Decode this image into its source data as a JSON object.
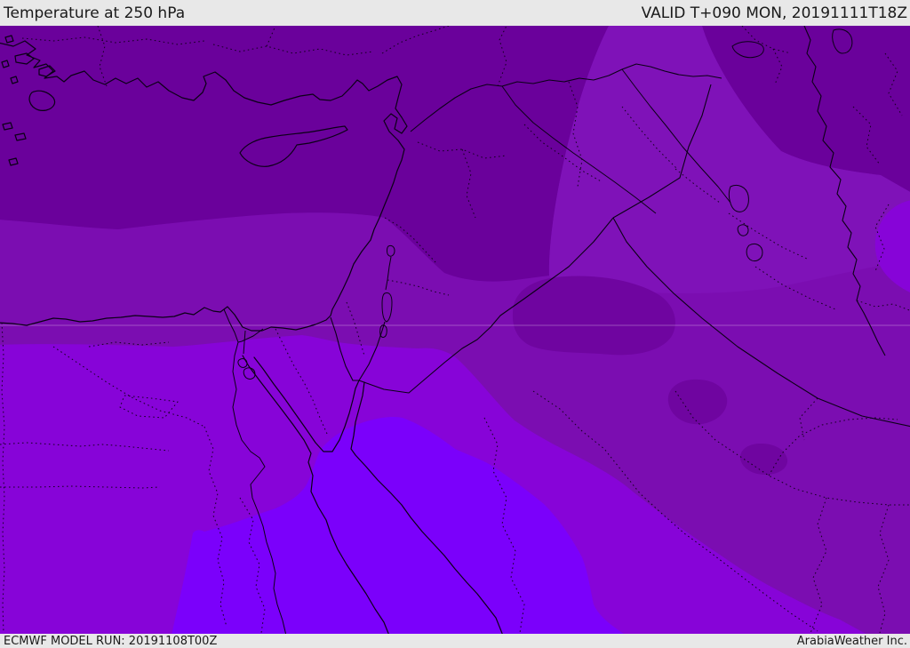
{
  "header": {
    "title": "Temperature at 250 hPa",
    "valid": "VALID T+090 MON, 20191111T18Z"
  },
  "footer": {
    "model_run": "ECMWF MODEL RUN: 20191108T00Z",
    "provider": "ArabiaWeather Inc."
  },
  "map": {
    "parameter": "Temperature",
    "pressure_level": "250 hPa",
    "region": "Eastern Mediterranean / Middle East",
    "bar_background": "#E8E8E8",
    "text_color": "#1a1a1a",
    "line_color": "#0b0016",
    "gridline_color": "rgba(255,235,255,0.30)",
    "temperature_bands": [
      {
        "name": "coldest-north-band",
        "color": "#6A019B"
      },
      {
        "name": "cold-base-band",
        "color": "#7B0DB1"
      },
      {
        "name": "syria-iraq-tongue",
        "color": "#7F12B8"
      },
      {
        "name": "milder-south-band",
        "color": "#8704D8"
      },
      {
        "name": "warmest-south-band",
        "color": "#7B00FB"
      },
      {
        "name": "cold-pocket-blobs",
        "color": "#6F05A0"
      }
    ]
  }
}
